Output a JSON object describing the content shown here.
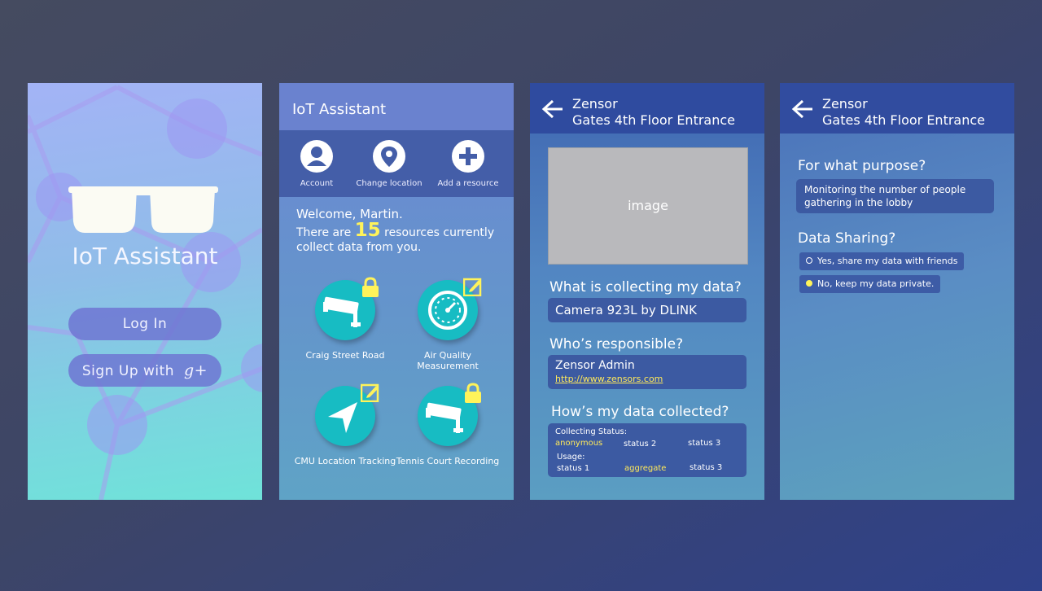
{
  "login": {
    "app_title": "IoT Assistant",
    "login_label": "Log In",
    "signup_label": "Sign Up with",
    "gplus_label": "g+"
  },
  "home": {
    "title": "IoT Assistant",
    "actions": [
      {
        "label": "Account",
        "icon": "person-icon"
      },
      {
        "label": "Change location",
        "icon": "location-pin-icon"
      },
      {
        "label": "Add a resource",
        "icon": "plus-icon"
      }
    ],
    "welcome": "Welcome, Martin.",
    "count_prefix": "There are",
    "count": "15",
    "count_suffix": "resources currently collect data from you.",
    "resources": [
      {
        "label": "Craig Street Road",
        "icon": "camera-icon",
        "badge": "lock-icon"
      },
      {
        "label": "Air Quality Measurement",
        "icon": "gauge-icon",
        "badge": "edit-icon"
      },
      {
        "label": "CMU Location Tracking",
        "icon": "navigation-arrow-icon",
        "badge": "edit-icon"
      },
      {
        "label": "Tennis Court Recording",
        "icon": "camera-icon",
        "badge": "lock-icon"
      }
    ]
  },
  "detail": {
    "header_line1": "Zensor",
    "header_line2": "Gates 4th Floor Entrance",
    "image_placeholder": "image",
    "q_what": "What is collecting my data?",
    "what_value": "Camera 923L by DLINK",
    "q_who": "Who’s responsible?",
    "who_name": "Zensor Admin",
    "who_link": "http://www.zensors.com",
    "q_how": "How’s my data collected?",
    "collecting_label": "Collecting Status:",
    "collecting": [
      "anonymous",
      "status 2",
      "status 3"
    ],
    "usage_label": "Usage:",
    "usage": [
      "status 1",
      "aggregate",
      "status 3"
    ]
  },
  "sharing": {
    "header_line1": "Zensor",
    "header_line2": "Gates 4th Floor Entrance",
    "q_purpose": "For what purpose?",
    "purpose_value": "Monitoring the number of people gathering in the lobby",
    "q_sharing": "Data Sharing?",
    "option_yes": "Yes, share my data with friends",
    "option_no": "No, keep my data private.",
    "selected": "no"
  },
  "colors": {
    "accent_yellow": "#fff35a",
    "resource_teal": "#17bcc3",
    "header_blue": "#2f4b9f"
  }
}
